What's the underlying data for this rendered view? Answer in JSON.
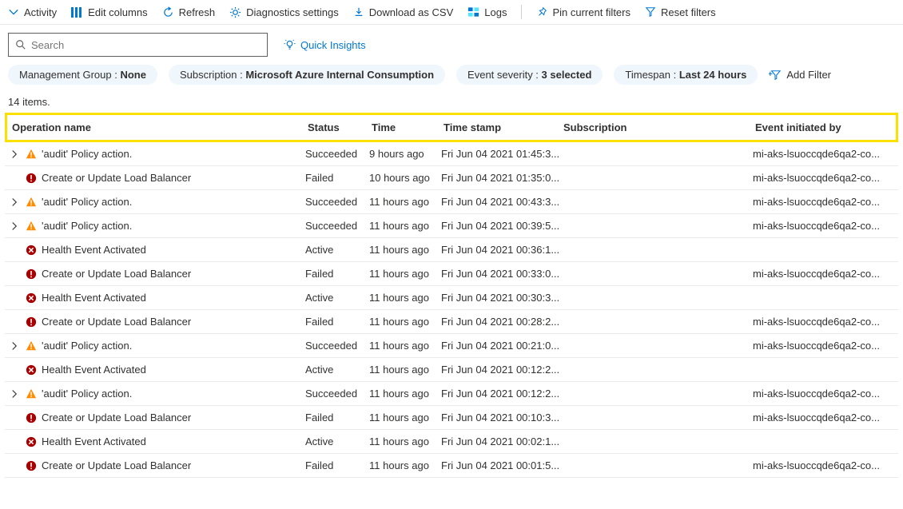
{
  "toolbar": {
    "activity": "Activity",
    "edit_columns": "Edit columns",
    "refresh": "Refresh",
    "diagnostics": "Diagnostics settings",
    "download": "Download as CSV",
    "logs": "Logs",
    "pin": "Pin current filters",
    "reset": "Reset filters"
  },
  "search": {
    "placeholder": "Search"
  },
  "quick_insights_label": "Quick Insights",
  "filters": {
    "mgmt_label": "Management Group : ",
    "mgmt_value": "None",
    "sub_label": "Subscription : ",
    "sub_value": "Microsoft Azure Internal Consumption",
    "severity_label": "Event severity : ",
    "severity_value": "3 selected",
    "timespan_label": "Timespan : ",
    "timespan_value": "Last 24 hours",
    "add_filter": "Add Filter"
  },
  "items_count": "14 items.",
  "columns": {
    "operation": "Operation name",
    "status": "Status",
    "time": "Time",
    "timestamp": "Time stamp",
    "subscription": "Subscription",
    "initiated": "Event initiated by"
  },
  "rows": [
    {
      "expandable": true,
      "icon": "warning",
      "op": "'audit' Policy action.",
      "status": "Succeeded",
      "time": "9 hours ago",
      "ts": "Fri Jun 04 2021 01:45:3...",
      "sub": "",
      "initiated": "mi-aks-lsuoccqde6qa2-co..."
    },
    {
      "expandable": false,
      "icon": "error",
      "op": "Create or Update Load Balancer",
      "status": "Failed",
      "time": "10 hours ago",
      "ts": "Fri Jun 04 2021 01:35:0...",
      "sub": "",
      "initiated": "mi-aks-lsuoccqde6qa2-co..."
    },
    {
      "expandable": true,
      "icon": "warning",
      "op": "'audit' Policy action.",
      "status": "Succeeded",
      "time": "11 hours ago",
      "ts": "Fri Jun 04 2021 00:43:3...",
      "sub": "",
      "initiated": "mi-aks-lsuoccqde6qa2-co..."
    },
    {
      "expandable": true,
      "icon": "warning",
      "op": "'audit' Policy action.",
      "status": "Succeeded",
      "time": "11 hours ago",
      "ts": "Fri Jun 04 2021 00:39:5...",
      "sub": "",
      "initiated": "mi-aks-lsuoccqde6qa2-co..."
    },
    {
      "expandable": false,
      "icon": "close",
      "op": "Health Event Activated",
      "status": "Active",
      "time": "11 hours ago",
      "ts": "Fri Jun 04 2021 00:36:1...",
      "sub": "",
      "initiated": ""
    },
    {
      "expandable": false,
      "icon": "error",
      "op": "Create or Update Load Balancer",
      "status": "Failed",
      "time": "11 hours ago",
      "ts": "Fri Jun 04 2021 00:33:0...",
      "sub": "",
      "initiated": "mi-aks-lsuoccqde6qa2-co..."
    },
    {
      "expandable": false,
      "icon": "close",
      "op": "Health Event Activated",
      "status": "Active",
      "time": "11 hours ago",
      "ts": "Fri Jun 04 2021 00:30:3...",
      "sub": "",
      "initiated": ""
    },
    {
      "expandable": false,
      "icon": "error",
      "op": "Create or Update Load Balancer",
      "status": "Failed",
      "time": "11 hours ago",
      "ts": "Fri Jun 04 2021 00:28:2...",
      "sub": "",
      "initiated": "mi-aks-lsuoccqde6qa2-co..."
    },
    {
      "expandable": true,
      "icon": "warning",
      "op": "'audit' Policy action.",
      "status": "Succeeded",
      "time": "11 hours ago",
      "ts": "Fri Jun 04 2021 00:21:0...",
      "sub": "",
      "initiated": "mi-aks-lsuoccqde6qa2-co..."
    },
    {
      "expandable": false,
      "icon": "close",
      "op": "Health Event Activated",
      "status": "Active",
      "time": "11 hours ago",
      "ts": "Fri Jun 04 2021 00:12:2...",
      "sub": "",
      "initiated": ""
    },
    {
      "expandable": true,
      "icon": "warning",
      "op": "'audit' Policy action.",
      "status": "Succeeded",
      "time": "11 hours ago",
      "ts": "Fri Jun 04 2021 00:12:2...",
      "sub": "",
      "initiated": "mi-aks-lsuoccqde6qa2-co..."
    },
    {
      "expandable": false,
      "icon": "error",
      "op": "Create or Update Load Balancer",
      "status": "Failed",
      "time": "11 hours ago",
      "ts": "Fri Jun 04 2021 00:10:3...",
      "sub": "",
      "initiated": "mi-aks-lsuoccqde6qa2-co..."
    },
    {
      "expandable": false,
      "icon": "close",
      "op": "Health Event Activated",
      "status": "Active",
      "time": "11 hours ago",
      "ts": "Fri Jun 04 2021 00:02:1...",
      "sub": "",
      "initiated": ""
    },
    {
      "expandable": false,
      "icon": "error",
      "op": "Create or Update Load Balancer",
      "status": "Failed",
      "time": "11 hours ago",
      "ts": "Fri Jun 04 2021 00:01:5...",
      "sub": "",
      "initiated": "mi-aks-lsuoccqde6qa2-co..."
    }
  ]
}
